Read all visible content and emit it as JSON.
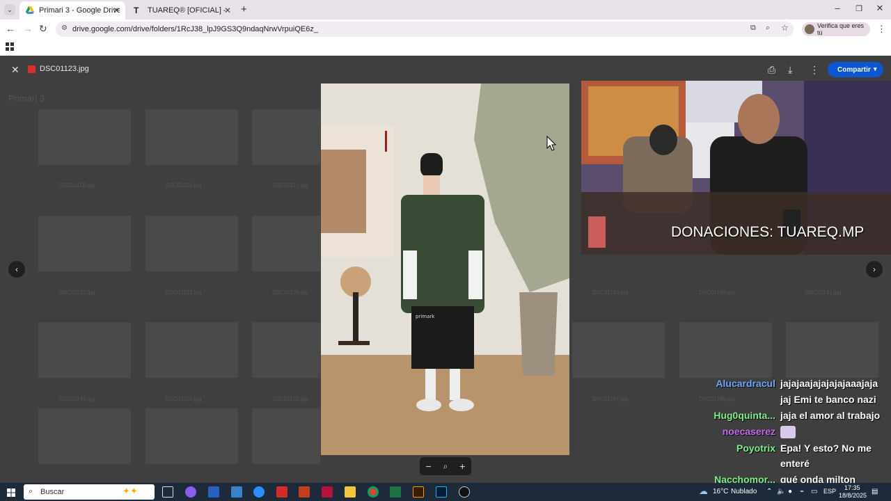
{
  "browser": {
    "tabs": [
      {
        "title": "Primari 3 - Google Drive",
        "active": true
      },
      {
        "title": "TUAREQ® [OFICIAL] – VER TOD",
        "active": false
      }
    ],
    "url": "drive.google.com/drive/folders/1RcJ38_lpJ9GS3Q9ndaqNrwVrpuiQE6z_",
    "profile_label": "Verifica que eres tú"
  },
  "viewer": {
    "filename": "DSC01123.jpg",
    "share_label": "Compartir",
    "folder_title": "Primari 3",
    "bg_labels": [
      "DSC01118.jpg",
      "DSC01120.jpg",
      "DSC01121.jpg",
      "DSC01132.jpg",
      "DSC01133.jpg",
      "DSC01135.jpg",
      "DSC01144.jpg",
      "DSC01146.jpg",
      "DSC01141.jpg",
      "DSC01149.jpg",
      "DSC01150.jpg",
      "DSC01153.jpg",
      "DSC01187.jpg",
      "DSC01189.jpg"
    ],
    "photo_brand": "primark"
  },
  "stream": {
    "donations": "DONACIONES: TUAREQ.MP"
  },
  "chat": [
    {
      "user": "Alucardracul",
      "color": "#6fa8ff",
      "lines": [
        "jajajaajajajajajaaajaja",
        "jaj Emi te banco nazi"
      ]
    },
    {
      "user": "Hug0quinta...",
      "color": "#7cf08a",
      "lines": [
        "jaja el amor al trabajo"
      ]
    },
    {
      "user": "noecaserez",
      "color": "#c06cf0",
      "lines": [
        ""
      ]
    },
    {
      "user": "Poyotrix",
      "color": "#7cf08a",
      "lines": [
        "Epa! Y esto? No me",
        "enteré"
      ]
    },
    {
      "user": "Nacchomor...",
      "color": "#7cf08a",
      "lines": [
        "qué onda milton"
      ]
    }
  ],
  "taskbar": {
    "search_placeholder": "Buscar",
    "weather_temp": "16°C",
    "weather_desc": "Nublado",
    "lang": "ESP",
    "time": "17:35",
    "date": "18/8/2025"
  }
}
